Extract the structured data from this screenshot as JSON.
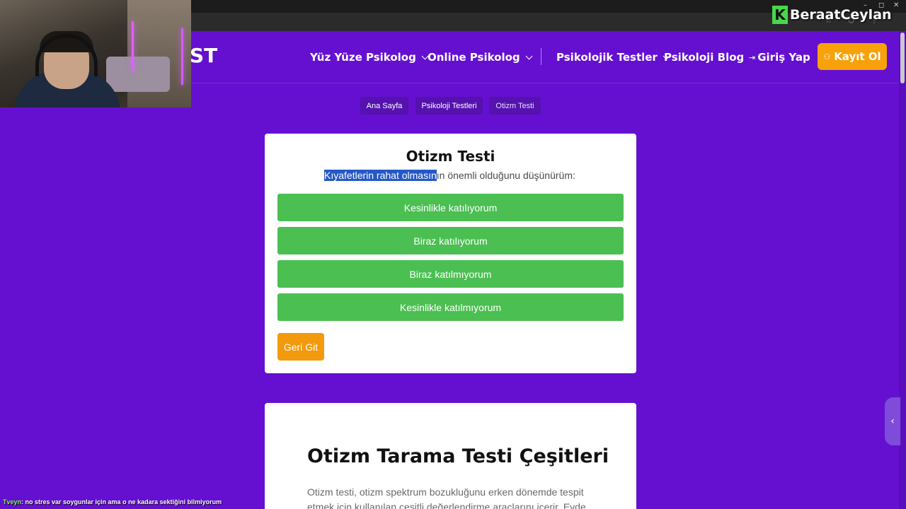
{
  "watermark": {
    "logo": "K",
    "name": "BeraatCeylan"
  },
  "browser": {
    "controls": [
      "–",
      "◻",
      "✕"
    ],
    "toolbar_icons": "☆ ⬡ ⋮"
  },
  "site": {
    "logo_text": "ST",
    "nav": {
      "yuz_yuze": "Yüz Yüze Psikolog",
      "online": "Online Psikolog",
      "testler": "Psikolojik Testler",
      "blog": "Psikoloji Blog",
      "giris": "Giriş Yap",
      "kayit": "Kayıt Ol"
    }
  },
  "breadcrumb": {
    "home": "Ana Sayfa",
    "tests": "Psikoloji Testleri",
    "current": "Otizm Testi"
  },
  "quiz": {
    "title": "Otizm Testi",
    "question_highlighted": "Kıyafetlerin rahat olmasın",
    "question_rest": "ın önemli olduğunu düşünürüm:",
    "answers": [
      "Kesinlikle katılıyorum",
      "Biraz katılıyorum",
      "Biraz katılmıyorum",
      "Kesinlikle katılmıyorum"
    ],
    "back": "Geri Git"
  },
  "article": {
    "title": "Otizm Tarama Testi Çeşitleri",
    "text": "Otizm testi, otizm spektrum bozukluğunu erken dönemde tespit etmek için kullanılan çeşitli değerlendirme araçlarını içerir. Evde"
  },
  "chat": {
    "user": "Tveyn",
    "message": ": no stres var soygunlar için ama o ne kadara sektiğini bilmiyorum"
  },
  "colors": {
    "background": "#6510d0",
    "accent": "#f8a10a",
    "answer_green": "#4bbf52"
  }
}
